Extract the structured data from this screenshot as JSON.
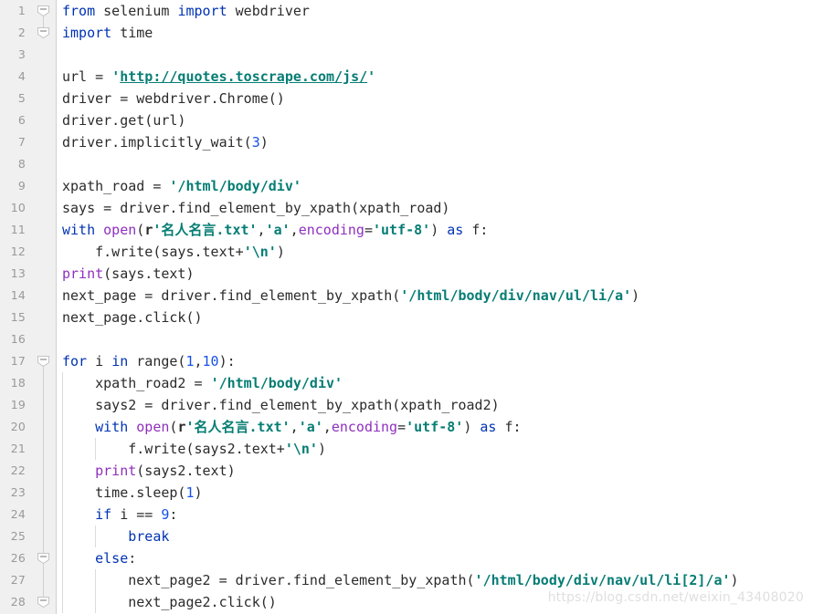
{
  "editor": {
    "language": "python",
    "font_size_px": 15,
    "line_height_px": 24,
    "background": "#ffffff",
    "gutter_background": "#f0f0f0",
    "gutter_text_color": "#999999",
    "colors": {
      "text": "#2b2b2b",
      "keyword": "#0033b3",
      "builtin": "#8f2fbf",
      "string": "#067d74",
      "number": "#1750eb",
      "keyword_argument": "#8f2fbf",
      "link": "#067d74",
      "indent_guide": "#dcdcdc",
      "fold_marker": "#cfcfcf",
      "watermark": "#dfdfdf"
    }
  },
  "watermark": {
    "text": "https://blog.csdn.net/weixin_43408020"
  },
  "lines": [
    {
      "number": "1",
      "fold": "minus-open",
      "fold_line": "bottom",
      "indents": [],
      "tokens": [
        {
          "cls": "t-kw",
          "text": "from"
        },
        {
          "cls": "t-plain",
          "text": " selenium "
        },
        {
          "cls": "t-kw",
          "text": "import"
        },
        {
          "cls": "t-plain",
          "text": " webdriver"
        }
      ]
    },
    {
      "number": "2",
      "fold": "minus-close",
      "fold_line": "top",
      "indents": [],
      "tokens": [
        {
          "cls": "t-kw",
          "text": "import"
        },
        {
          "cls": "t-plain",
          "text": " time"
        }
      ]
    },
    {
      "number": "3",
      "fold": "none",
      "fold_line": "none",
      "indents": [],
      "tokens": []
    },
    {
      "number": "4",
      "fold": "none",
      "fold_line": "none",
      "indents": [],
      "tokens": [
        {
          "cls": "t-plain",
          "text": "url = "
        },
        {
          "cls": "t-strq",
          "text": "'"
        },
        {
          "cls": "t-link",
          "text": "http://quotes.toscrape.com/js/"
        },
        {
          "cls": "t-strq",
          "text": "'"
        }
      ]
    },
    {
      "number": "5",
      "fold": "none",
      "fold_line": "none",
      "indents": [],
      "tokens": [
        {
          "cls": "t-plain",
          "text": "driver = webdriver.Chrome()"
        }
      ]
    },
    {
      "number": "6",
      "fold": "none",
      "fold_line": "none",
      "indents": [],
      "tokens": [
        {
          "cls": "t-plain",
          "text": "driver.get(url)"
        }
      ]
    },
    {
      "number": "7",
      "fold": "none",
      "fold_line": "none",
      "indents": [],
      "tokens": [
        {
          "cls": "t-plain",
          "text": "driver.implicitly_wait("
        },
        {
          "cls": "t-num",
          "text": "3"
        },
        {
          "cls": "t-plain",
          "text": ")"
        }
      ]
    },
    {
      "number": "8",
      "fold": "none",
      "fold_line": "none",
      "indents": [],
      "tokens": []
    },
    {
      "number": "9",
      "fold": "none",
      "fold_line": "none",
      "indents": [],
      "tokens": [
        {
          "cls": "t-plain",
          "text": "xpath_road = "
        },
        {
          "cls": "t-str",
          "text": "'/html/body/div'"
        }
      ]
    },
    {
      "number": "10",
      "fold": "none",
      "fold_line": "none",
      "indents": [],
      "tokens": [
        {
          "cls": "t-plain",
          "text": "says = driver.find_element_by_xpath(xpath_road)"
        }
      ]
    },
    {
      "number": "11",
      "fold": "none",
      "fold_line": "none",
      "indents": [],
      "tokens": [
        {
          "cls": "t-kw",
          "text": "with"
        },
        {
          "cls": "t-plain",
          "text": " "
        },
        {
          "cls": "t-builtin",
          "text": "open"
        },
        {
          "cls": "t-plain",
          "text": "("
        },
        {
          "cls": "t-prefix",
          "text": "r"
        },
        {
          "cls": "t-str",
          "text": "'"
        },
        {
          "cls": "t-cjk",
          "text": "名人名言"
        },
        {
          "cls": "t-str",
          "text": ".txt'"
        },
        {
          "cls": "t-plain",
          "text": ","
        },
        {
          "cls": "t-str",
          "text": "'a'"
        },
        {
          "cls": "t-plain",
          "text": ","
        },
        {
          "cls": "t-kwarg",
          "text": "encoding"
        },
        {
          "cls": "t-plain",
          "text": "="
        },
        {
          "cls": "t-str",
          "text": "'utf-8'"
        },
        {
          "cls": "t-plain",
          "text": ") "
        },
        {
          "cls": "t-kw",
          "text": "as"
        },
        {
          "cls": "t-plain",
          "text": " f:"
        }
      ]
    },
    {
      "number": "12",
      "fold": "none",
      "fold_line": "none",
      "indents": [],
      "tokens": [
        {
          "cls": "t-plain",
          "text": "    f.write(says.text+"
        },
        {
          "cls": "t-str",
          "text": "'\\n'"
        },
        {
          "cls": "t-plain",
          "text": ")"
        }
      ]
    },
    {
      "number": "13",
      "fold": "none",
      "fold_line": "none",
      "indents": [],
      "tokens": [
        {
          "cls": "t-builtin",
          "text": "print"
        },
        {
          "cls": "t-plain",
          "text": "(says.text)"
        }
      ]
    },
    {
      "number": "14",
      "fold": "none",
      "fold_line": "none",
      "indents": [],
      "tokens": [
        {
          "cls": "t-plain",
          "text": "next_page = driver.find_element_by_xpath("
        },
        {
          "cls": "t-str",
          "text": "'/html/body/div/nav/ul/li/a'"
        },
        {
          "cls": "t-plain",
          "text": ")"
        }
      ]
    },
    {
      "number": "15",
      "fold": "none",
      "fold_line": "none",
      "indents": [],
      "tokens": [
        {
          "cls": "t-plain",
          "text": "next_page.click()"
        }
      ]
    },
    {
      "number": "16",
      "fold": "none",
      "fold_line": "none",
      "indents": [],
      "tokens": []
    },
    {
      "number": "17",
      "fold": "minus-open",
      "fold_line": "bottom",
      "indents": [],
      "tokens": [
        {
          "cls": "t-kw",
          "text": "for"
        },
        {
          "cls": "t-plain",
          "text": " i "
        },
        {
          "cls": "t-kw",
          "text": "in"
        },
        {
          "cls": "t-plain",
          "text": " range("
        },
        {
          "cls": "t-num",
          "text": "1"
        },
        {
          "cls": "t-plain",
          "text": ","
        },
        {
          "cls": "t-num",
          "text": "10"
        },
        {
          "cls": "t-plain",
          "text": "):"
        }
      ]
    },
    {
      "number": "18",
      "fold": "none",
      "fold_line": "line",
      "indents": [
        0
      ],
      "tokens": [
        {
          "cls": "t-plain",
          "text": "    xpath_road2 = "
        },
        {
          "cls": "t-str",
          "text": "'/html/body/div'"
        }
      ]
    },
    {
      "number": "19",
      "fold": "none",
      "fold_line": "line",
      "indents": [
        0
      ],
      "tokens": [
        {
          "cls": "t-plain",
          "text": "    says2 = driver.find_element_by_xpath(xpath_road2)"
        }
      ]
    },
    {
      "number": "20",
      "fold": "none",
      "fold_line": "line",
      "indents": [
        0
      ],
      "tokens": [
        {
          "cls": "t-plain",
          "text": "    "
        },
        {
          "cls": "t-kw",
          "text": "with"
        },
        {
          "cls": "t-plain",
          "text": " "
        },
        {
          "cls": "t-builtin",
          "text": "open"
        },
        {
          "cls": "t-plain",
          "text": "("
        },
        {
          "cls": "t-prefix",
          "text": "r"
        },
        {
          "cls": "t-str",
          "text": "'"
        },
        {
          "cls": "t-cjk",
          "text": "名人名言"
        },
        {
          "cls": "t-str",
          "text": ".txt'"
        },
        {
          "cls": "t-plain",
          "text": ","
        },
        {
          "cls": "t-str",
          "text": "'a'"
        },
        {
          "cls": "t-plain",
          "text": ","
        },
        {
          "cls": "t-kwarg",
          "text": "encoding"
        },
        {
          "cls": "t-plain",
          "text": "="
        },
        {
          "cls": "t-str",
          "text": "'utf-8'"
        },
        {
          "cls": "t-plain",
          "text": ") "
        },
        {
          "cls": "t-kw",
          "text": "as"
        },
        {
          "cls": "t-plain",
          "text": " f:"
        }
      ]
    },
    {
      "number": "21",
      "fold": "none",
      "fold_line": "line",
      "indents": [
        0,
        36
      ],
      "tokens": [
        {
          "cls": "t-plain",
          "text": "        f.write(says2.text+"
        },
        {
          "cls": "t-str",
          "text": "'\\n'"
        },
        {
          "cls": "t-plain",
          "text": ")"
        }
      ]
    },
    {
      "number": "22",
      "fold": "none",
      "fold_line": "line",
      "indents": [
        0
      ],
      "tokens": [
        {
          "cls": "t-plain",
          "text": "    "
        },
        {
          "cls": "t-builtin",
          "text": "print"
        },
        {
          "cls": "t-plain",
          "text": "(says2.text)"
        }
      ]
    },
    {
      "number": "23",
      "fold": "none",
      "fold_line": "line",
      "indents": [
        0
      ],
      "tokens": [
        {
          "cls": "t-plain",
          "text": "    time.sleep("
        },
        {
          "cls": "t-num",
          "text": "1"
        },
        {
          "cls": "t-plain",
          "text": ")"
        }
      ]
    },
    {
      "number": "24",
      "fold": "none",
      "fold_line": "line",
      "indents": [
        0
      ],
      "tokens": [
        {
          "cls": "t-plain",
          "text": "    "
        },
        {
          "cls": "t-kw",
          "text": "if"
        },
        {
          "cls": "t-plain",
          "text": " i == "
        },
        {
          "cls": "t-num",
          "text": "9"
        },
        {
          "cls": "t-plain",
          "text": ":"
        }
      ]
    },
    {
      "number": "25",
      "fold": "none",
      "fold_line": "line",
      "indents": [
        0,
        36
      ],
      "tokens": [
        {
          "cls": "t-plain",
          "text": "        "
        },
        {
          "cls": "t-kw",
          "text": "break"
        }
      ]
    },
    {
      "number": "26",
      "fold": "minus-open",
      "fold_line": "both",
      "indents": [
        0
      ],
      "tokens": [
        {
          "cls": "t-plain",
          "text": "    "
        },
        {
          "cls": "t-kw",
          "text": "else"
        },
        {
          "cls": "t-plain",
          "text": ":"
        }
      ]
    },
    {
      "number": "27",
      "fold": "none",
      "fold_line": "line",
      "indents": [
        0,
        36
      ],
      "tokens": [
        {
          "cls": "t-plain",
          "text": "        next_page2 = driver.find_element_by_xpath("
        },
        {
          "cls": "t-str",
          "text": "'/html/body/div/nav/ul/li[2]/a'"
        },
        {
          "cls": "t-plain",
          "text": ")"
        }
      ]
    },
    {
      "number": "28",
      "fold": "minus-close",
      "fold_line": "top",
      "indents": [
        0,
        36
      ],
      "tokens": [
        {
          "cls": "t-plain",
          "text": "        next_page2.click()"
        }
      ]
    }
  ]
}
